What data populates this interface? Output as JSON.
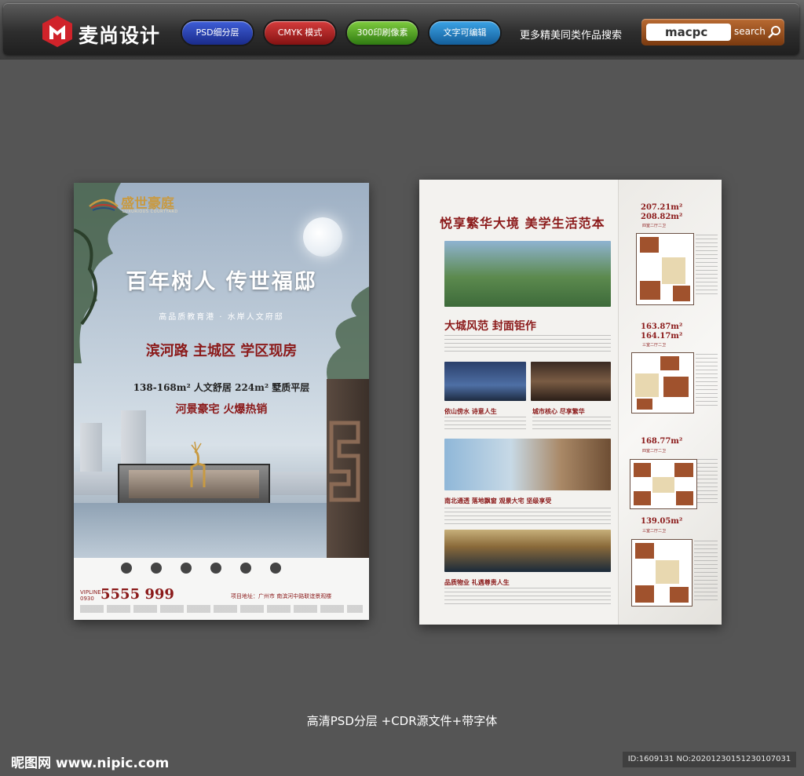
{
  "header": {
    "brand": "麦尚设计",
    "badges": [
      "PSD细分层",
      "CMYK 模式",
      "300印刷像素",
      "文字可编辑"
    ],
    "tagline": "更多精美同类作品搜索",
    "search_value": "macpc",
    "search_label": "search"
  },
  "front_poster": {
    "brand": "盛世豪庭",
    "brand_en": "LUXURIOUS COURTYARD",
    "headline": "百年树人  传世福邸",
    "subline": "高品质教育港 · 水岸人文府邸",
    "red_line": "滨河路  主城区  学区现房",
    "areas": "138-168m² 人文舒居   224m² 墅质平层",
    "promo": "河景豪宅  火爆热销",
    "phone_prefix": "VIPLINE 0930",
    "phone": "5555 999",
    "address": "项目地址：广州市    南滨河中路联谊景观楼"
  },
  "back_poster": {
    "title": "悦享繁华大境  美学生活范本",
    "section1": "大城风范  封面钜作",
    "sub_a": "依山傍水  诗意人生",
    "sub_b": "城市核心  尽享繁华",
    "sub_c": "南北通透  落地飘窗  观景大宅  坚级享受",
    "sub_d": "品质物业  礼遇尊贵人生",
    "plans": [
      {
        "area": "207.21m²",
        "area2": "208.82m²",
        "type": "四室二厅二卫"
      },
      {
        "area": "163.87m²",
        "area2": "164.17m²",
        "type": "三室二厅二卫"
      },
      {
        "area": "168.77m²",
        "area2": "",
        "type": "四室二厅二卫"
      },
      {
        "area": "139.05m²",
        "area2": "",
        "type": "三室二厅二卫"
      }
    ]
  },
  "caption": "高清PSD分层 +CDR源文件+带字体",
  "footer": {
    "site": "昵图网 www.nipic.com",
    "id_text": "ID:1609131 NO:20201230151230107031"
  }
}
